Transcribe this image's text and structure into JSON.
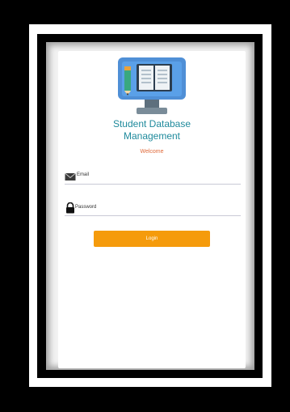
{
  "app": {
    "title_line1": "Student Database",
    "title_line2": "Management",
    "welcome": "Welcome"
  },
  "form": {
    "email_label": "Email",
    "password_label": "Password",
    "login_label": "Login"
  },
  "icons": {
    "logo": "monitor-book-icon",
    "email": "mail-icon",
    "password": "lock-icon"
  },
  "colors": {
    "title": "#1f8a9c",
    "welcome": "#e06a3a",
    "button": "#f59b0c"
  }
}
